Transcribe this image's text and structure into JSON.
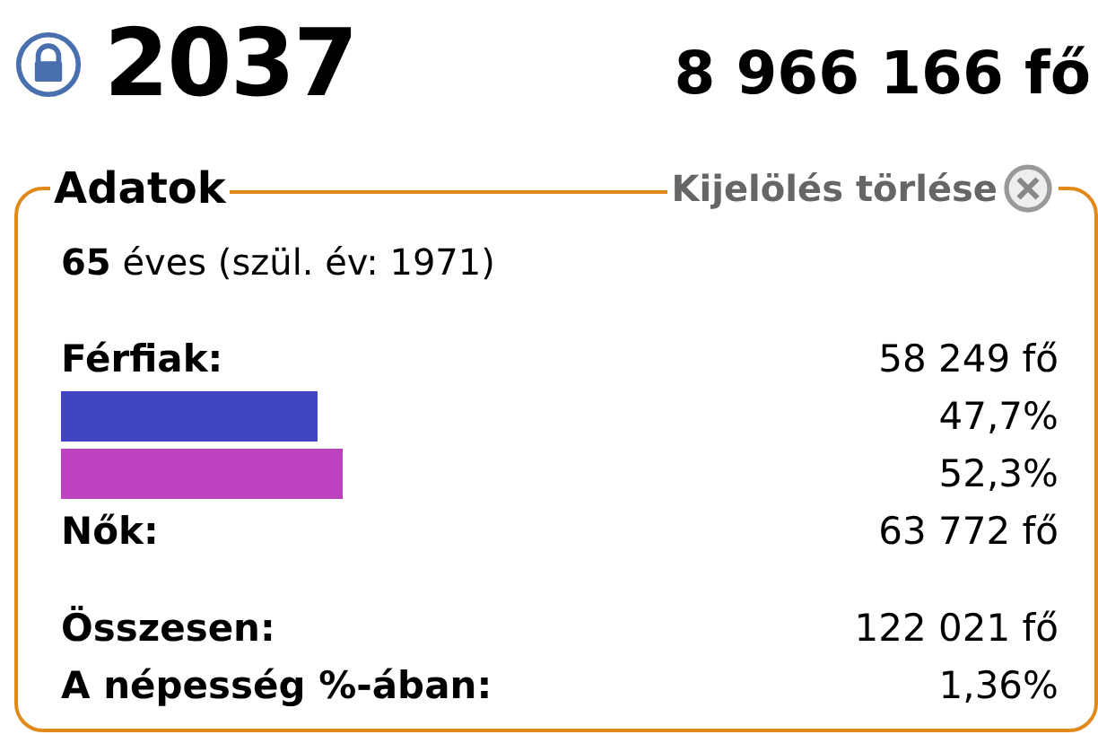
{
  "header": {
    "year": "2037",
    "population": "8 966 166 fő"
  },
  "panel": {
    "title": "Adatok",
    "clear_button": "Kijelölés törlése",
    "age_line": "**65** éves (szül. év: 1971)",
    "rows": [
      {
        "kind": "text",
        "label": "Férfiak:",
        "value": "58 249 fő"
      },
      {
        "kind": "bar",
        "color": "#4045c0",
        "value": "47,7%"
      },
      {
        "kind": "bar",
        "color": "#bc42c0",
        "value": "52,3%"
      },
      {
        "kind": "text",
        "label": "Nők:",
        "value": "63 772 fő"
      }
    ],
    "summary": [
      {
        "label": "Összesen:",
        "value": "122 021 fő"
      },
      {
        "label": "A népesség %-ában:",
        "value": "1,36%"
      }
    ]
  }
}
